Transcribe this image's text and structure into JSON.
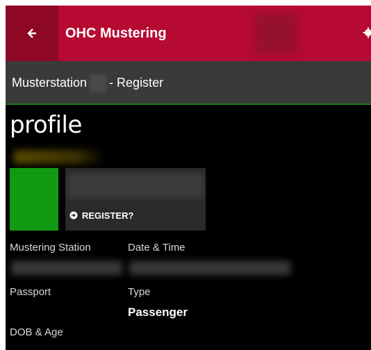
{
  "header": {
    "app_title": "OHC Mustering"
  },
  "subheader": {
    "prefix": "Musterstation",
    "suffix": "- Register"
  },
  "page": {
    "title": "profile"
  },
  "register": {
    "label": "REGISTER?"
  },
  "fields": {
    "mustering_station_label": "Mustering Station",
    "date_time_label": "Date & Time",
    "passport_label": "Passport",
    "type_label": "Type",
    "type_value": "Passenger",
    "dob_age_label": "DOB & Age"
  },
  "colors": {
    "title_bar": "#b70a32",
    "back_button": "#8e0823",
    "subheader": "#3a3a3a",
    "status_tile": "#129b12",
    "background": "#000000"
  },
  "icons": {
    "back": "arrow-left-icon",
    "settings": "gear-icon",
    "register": "sign-in-icon"
  }
}
